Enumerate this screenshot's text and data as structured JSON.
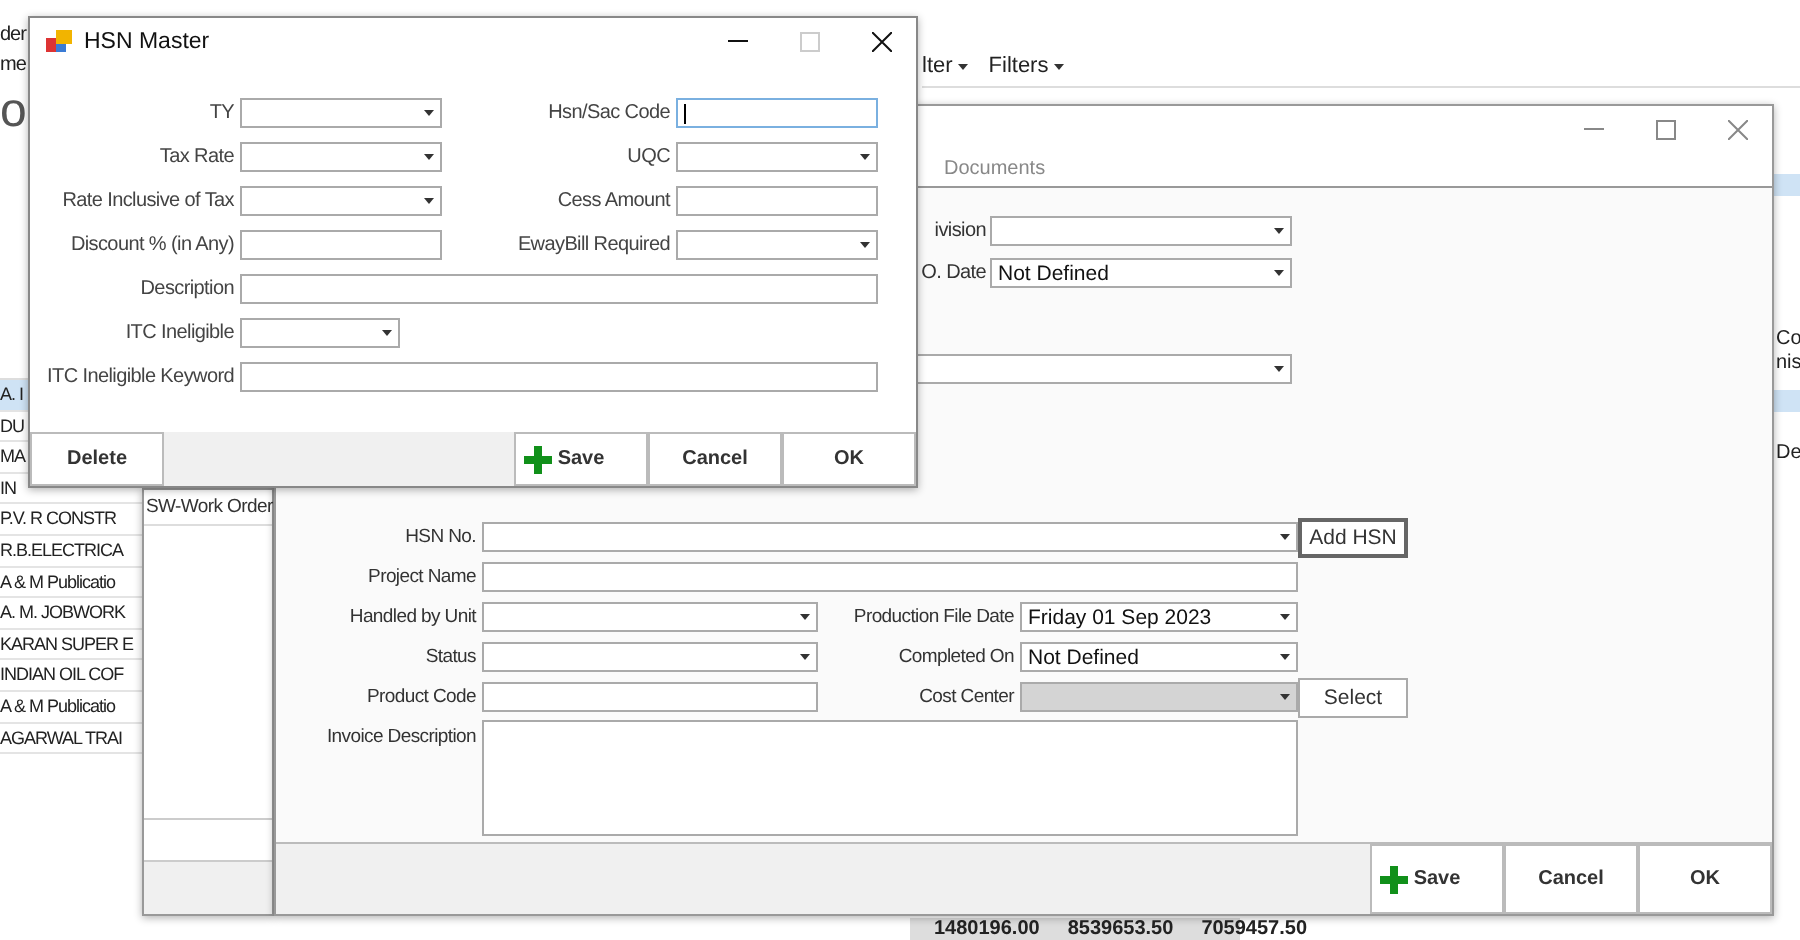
{
  "background": {
    "header_texts": [
      "der",
      "me"
    ],
    "heading": "o",
    "menu": [
      "lter",
      "Filters"
    ],
    "list": [
      {
        "text": "A. I",
        "selected": true
      },
      {
        "text": "DU",
        "selected": false
      },
      {
        "text": "MA",
        "selected": false
      },
      {
        "text": "IN",
        "selected": false
      },
      {
        "text": "P.V. R CONSTR",
        "selected": false
      },
      {
        "text": "R.B.ELECTRICA",
        "selected": false
      },
      {
        "text": "A & M Publicatio",
        "selected": false
      },
      {
        "text": "A. M. JOBWORK",
        "selected": false
      },
      {
        "text": "KARAN SUPER E",
        "selected": false
      },
      {
        "text": "INDIAN OIL COF",
        "selected": false
      },
      {
        "text": "A & M Publicatio",
        "selected": false
      },
      {
        "text": "AGARWAL TRAI",
        "selected": false
      }
    ],
    "edge_texts": [
      "Co",
      "nis",
      "De"
    ],
    "totals": [
      "1480196.00",
      "8539653.50",
      "7059457.50"
    ]
  },
  "work_order_window": {
    "list_header": "SW-Work Order"
  },
  "project_window": {
    "tab": "Documents",
    "top_fields": [
      {
        "label": "ivision",
        "kind": "select"
      },
      {
        "label": "O. Date",
        "kind": "select",
        "value": "Not Defined"
      },
      {
        "kind": "select"
      }
    ],
    "fields": [
      {
        "label": "HSN No.",
        "kind": "select",
        "wide": true,
        "button": "Add HSN"
      },
      {
        "label": "Project Name",
        "kind": "text",
        "wide": true
      },
      {
        "label": "Handled by Unit",
        "kind": "select"
      },
      {
        "label": "Production File Date",
        "kind": "select",
        "value": "Friday 01 Sep 2023"
      },
      {
        "label": "Status",
        "kind": "select"
      },
      {
        "label": "Completed On",
        "kind": "select",
        "value": "Not Defined"
      },
      {
        "label": "Product Code",
        "kind": "text"
      },
      {
        "label": "Cost Center",
        "kind": "select",
        "disabled": true,
        "button": "Select"
      },
      {
        "label": "Invoice Description",
        "kind": "textarea",
        "wide": true
      }
    ],
    "buttons": [
      {
        "label": "Save",
        "kind": "add"
      },
      {
        "label": "Cancel",
        "kind": "plain"
      },
      {
        "label": "OK",
        "kind": "plain"
      }
    ]
  },
  "hsn_dialog": {
    "title": "HSN Master",
    "fields": [
      {
        "label": "TY",
        "kind": "select"
      },
      {
        "label": "Hsn/Sac Code",
        "kind": "text",
        "focused": true
      },
      {
        "label": "Tax Rate",
        "kind": "select"
      },
      {
        "label": "UQC",
        "kind": "select"
      },
      {
        "label": "Rate Inclusive of Tax",
        "kind": "select"
      },
      {
        "label": "Cess Amount",
        "kind": "text"
      },
      {
        "label": "Discount % (in Any)",
        "kind": "text"
      },
      {
        "label": "EwayBill Required",
        "kind": "select"
      },
      {
        "label": "Description",
        "kind": "text",
        "wide": true
      },
      {
        "label": "ITC Ineligible",
        "kind": "select",
        "short": true
      },
      {
        "label": "ITC Ineligible Keyword",
        "kind": "text",
        "wide": true
      }
    ],
    "delete_button": "Delete",
    "buttons": [
      {
        "label": "Save",
        "kind": "add"
      },
      {
        "label": "Cancel",
        "kind": "plain"
      },
      {
        "label": "OK",
        "kind": "plain"
      }
    ]
  }
}
